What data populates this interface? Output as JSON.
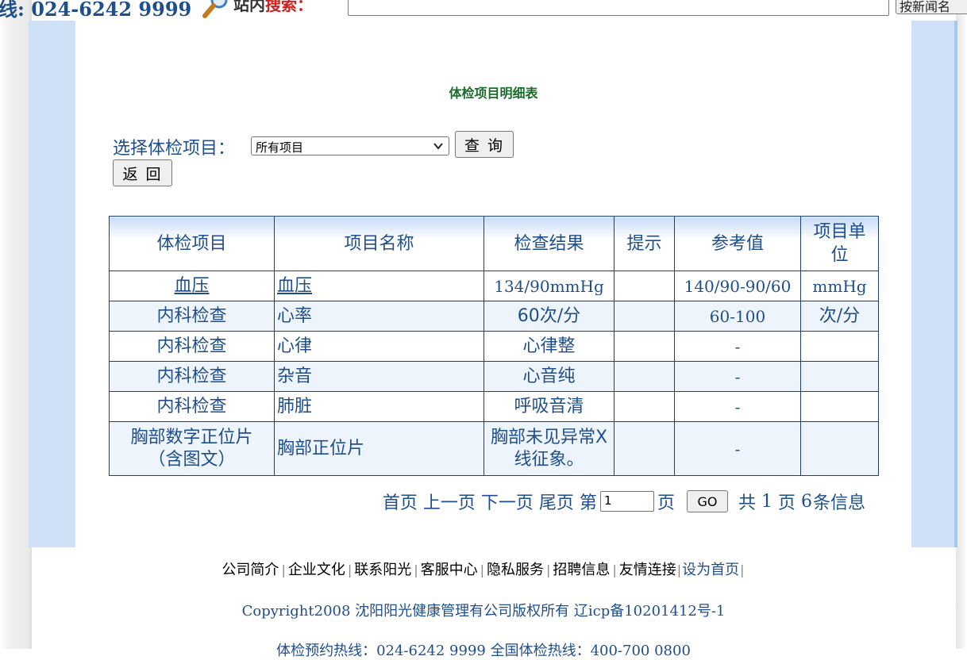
{
  "header": {
    "hotline": "线: 024-6242 9999",
    "search_label_part1": "站内",
    "search_label_part2": "搜索：",
    "search_input_value": "",
    "search_button_label": "按新闻名"
  },
  "page": {
    "title": "体检项目明细表",
    "filter_label": "选择体检项目：",
    "filter_selected": "所有项目",
    "query_button": "查 询",
    "back_button": "返 回"
  },
  "table": {
    "headers": [
      "体检项目",
      "项目名称",
      "检查结果",
      "提示",
      "参考值",
      "项目单位"
    ],
    "rows": [
      {
        "category": "血压",
        "name": "血压",
        "result": "134/90mmHg",
        "hint": "",
        "reference": "140/90-90/60",
        "unit": "mmHg"
      },
      {
        "category": "内科检查",
        "name": "心率",
        "result": "60次/分",
        "hint": "",
        "reference": "60-100",
        "unit": "次/分"
      },
      {
        "category": "内科检查",
        "name": "心律",
        "result": "心律整",
        "hint": "",
        "reference": "-",
        "unit": ""
      },
      {
        "category": "内科检查",
        "name": "杂音",
        "result": "心音纯",
        "hint": "",
        "reference": "-",
        "unit": ""
      },
      {
        "category": "内科检查",
        "name": "肺脏",
        "result": "呼吸音清",
        "hint": "",
        "reference": "-",
        "unit": ""
      },
      {
        "category": "胸部数字正位片（含图文）",
        "name": "胸部正位片",
        "result": "胸部未见异常X线征象。",
        "hint": "",
        "reference": "-",
        "unit": ""
      }
    ]
  },
  "pager": {
    "first": "首页",
    "prev": "上一页",
    "next": "下一页",
    "last": "尾页",
    "page_prefix": "第",
    "page_input_value": "1",
    "page_suffix": "页",
    "go_button": "GO",
    "total_prefix": "共",
    "total_pages": "1",
    "total_pages_suffix": "页",
    "total_records": "6",
    "total_records_suffix": "条信息"
  },
  "footer": {
    "links": [
      "公司简介",
      "企业文化",
      "联系阳光",
      "客服中心",
      "隐私服务",
      "招聘信息",
      "友情连接"
    ],
    "set_home": "设为首页",
    "copyright": "Copyright2008 沈阳阳光健康管理有公司版权所有 辽icp备10201412号-1",
    "hotlines": "体检预约热线：024-6242 9999 全国体检热线：400-700 0800"
  },
  "colors": {
    "link_blue": "#1f4e8c",
    "title_green": "#1a6b2a",
    "frame_blue": "#cfe0f7",
    "search_red": "#d61e1e"
  },
  "icons": [
    "magnifier-icon",
    "chevron-down-icon"
  ]
}
